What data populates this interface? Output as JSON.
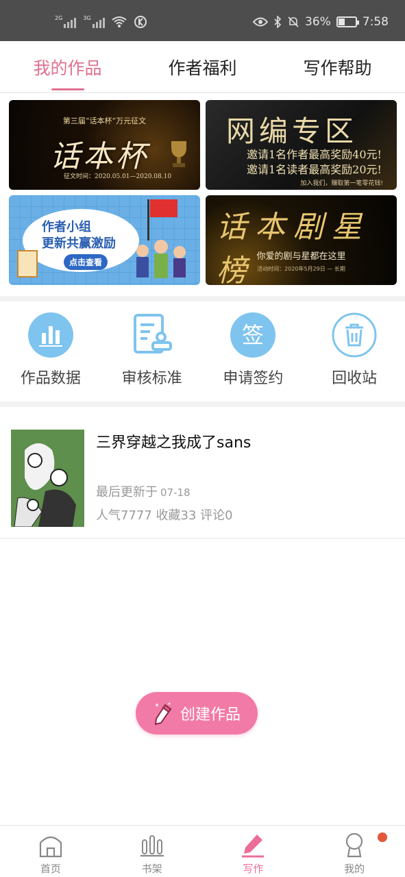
{
  "status_bar": {
    "net1": "2G",
    "net2": "3G",
    "battery_percent": "36%",
    "battery_level": 0.36,
    "time": "7:58",
    "icons": [
      "eye-icon",
      "bluetooth-icon",
      "mute-icon",
      "battery-icon"
    ]
  },
  "tabs": [
    {
      "label": "我的作品",
      "active": true
    },
    {
      "label": "作者福利",
      "active": false
    },
    {
      "label": "写作帮助",
      "active": false
    }
  ],
  "banners": {
    "b1": {
      "subtitle": "第三届“话本杯”万元征文",
      "title": "话本杯",
      "date": "征文时间：2020.05.01—2020.08.10"
    },
    "b2": {
      "title": "网编专区",
      "line1": "邀请1名作者最高奖励40元!",
      "line2": "邀请1名读者最高奖励20元!",
      "footer": "加入我们，赚取第一笔零花钱!"
    },
    "b3": {
      "line1": "作者小组",
      "line2": "更新共赢激励",
      "button": "点击查看"
    },
    "b4": {
      "title": "话本剧星榜",
      "subtitle": "你爱的剧与星都在这里",
      "footer": "活动时间：2020年5月29日 — 长期"
    }
  },
  "tools": [
    {
      "label": "作品数据",
      "icon": "bar-chart-icon"
    },
    {
      "label": "审核标准",
      "icon": "review-stamp-icon"
    },
    {
      "label": "申请签约",
      "icon": "sign-icon",
      "glyph": "签"
    },
    {
      "label": "回收站",
      "icon": "trash-icon"
    }
  ],
  "work": {
    "title": "三界穿越之我成了sans",
    "updated_label": "最后更新于",
    "updated_date": "07-18",
    "stats": "人气7777 收藏33 评论0"
  },
  "create_button": {
    "label": "创建作品"
  },
  "bottom_nav": [
    {
      "label": "首页",
      "icon": "home-icon"
    },
    {
      "label": "书架",
      "icon": "bookshelf-icon"
    },
    {
      "label": "写作",
      "icon": "pen-icon",
      "active": true
    },
    {
      "label": "我的",
      "icon": "profile-icon",
      "has_badge": true
    }
  ],
  "colors": {
    "accent": "#e0708f",
    "tool_blue": "#7ec4ee",
    "create_pink": "#f27aa6",
    "badge": "#e1583a"
  }
}
